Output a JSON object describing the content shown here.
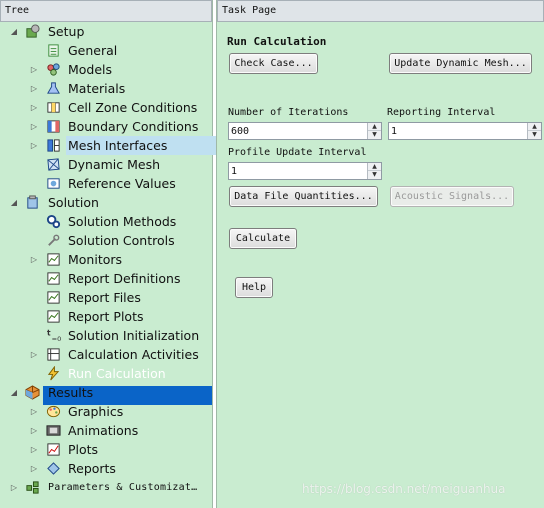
{
  "tree": {
    "header": "Tree",
    "setup": {
      "label": "Setup",
      "general": "General",
      "models": "Models",
      "materials": "Materials",
      "cell_zone_conditions": "Cell Zone Conditions",
      "boundary_conditions": "Boundary Conditions",
      "mesh_interfaces": "Mesh Interfaces",
      "dynamic_mesh": "Dynamic Mesh",
      "reference_values": "Reference Values"
    },
    "solution": {
      "label": "Solution",
      "solution_methods": "Solution Methods",
      "solution_controls": "Solution Controls",
      "monitors": "Monitors",
      "report_definitions": "Report Definitions",
      "report_files": "Report Files",
      "report_plots": "Report Plots",
      "solution_initialization": "Solution Initialization",
      "calculation_activities": "Calculation Activities",
      "run_calculation": "Run Calculation"
    },
    "results": {
      "label": "Results",
      "graphics": "Graphics",
      "animations": "Animations",
      "plots": "Plots",
      "reports": "Reports"
    },
    "parameters": "Parameters & Customizat…"
  },
  "task_page": {
    "header": "Task Page",
    "title": "Run Calculation",
    "check_case": "Check Case...",
    "update_dynamic_mesh": "Update Dynamic Mesh...",
    "iterations_label": "Number of Iterations",
    "iterations_value": "600",
    "reporting_interval_label": "Reporting Interval",
    "reporting_interval_value": "1",
    "profile_update_label": "Profile Update Interval",
    "profile_update_value": "1",
    "data_file_quantities": "Data File Quantities...",
    "acoustic_signals": "Acoustic Signals...",
    "calculate": "Calculate",
    "help": "Help"
  },
  "watermark": "https://blog.csdn.net/meiguanhua",
  "colors": {
    "panel_bg": "#c9ecd0",
    "selection": "#0a64c8",
    "hover_highlight": "#bfe0f1"
  }
}
